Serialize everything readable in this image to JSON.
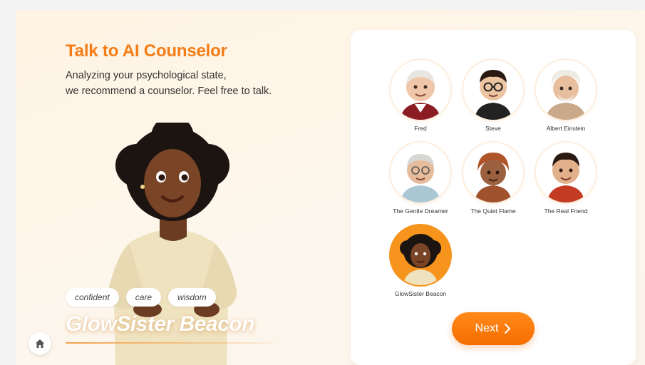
{
  "header": {
    "title": "Talk to AI Counselor",
    "subtitle_line1": "Analyzing your psychological state,",
    "subtitle_line2": "we recommend a counselor. Feel free to talk."
  },
  "hero": {
    "name": "GlowSister Beacon",
    "tags": [
      "confident",
      "care",
      "wisdom"
    ]
  },
  "counselors": [
    {
      "name": "Fred",
      "selected": false
    },
    {
      "name": "Steve",
      "selected": false
    },
    {
      "name": "Albert Einstein",
      "selected": false
    },
    {
      "name": "The Gentle Dreamer",
      "selected": false
    },
    {
      "name": "The Quiet Flame",
      "selected": false
    },
    {
      "name": "The Real Friend",
      "selected": false
    },
    {
      "name": "GlowSister Beacon",
      "selected": true
    }
  ],
  "actions": {
    "next_label": "Next"
  },
  "colors": {
    "accent": "#f57c15",
    "button": "#f56d00"
  },
  "icons": {
    "home": "home-icon",
    "next_arrow": "chevron-right-icon"
  }
}
